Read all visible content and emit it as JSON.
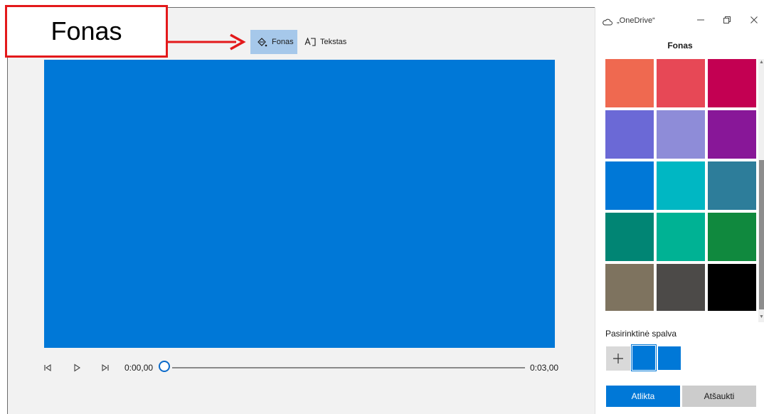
{
  "toolbar": {
    "background_label": "Fonas",
    "text_label": "Tekstas"
  },
  "callout": {
    "label": "Fonas",
    "color": "#e3191b"
  },
  "preview": {
    "color": "#0078d7"
  },
  "playback": {
    "current_time": "0:00,00",
    "total_time": "0:03,00",
    "progress": 0
  },
  "panel": {
    "app_title": "„OneDrive“",
    "title": "Fonas",
    "swatches": [
      "#ef6950",
      "#e74856",
      "#c30052",
      "#6b69d6",
      "#8e8cd8",
      "#881798",
      "#0078d7",
      "#00b7c3",
      "#2d7d9a",
      "#018574",
      "#00b294",
      "#10893e",
      "#7e735f",
      "#4c4a48",
      "#000000"
    ],
    "custom_label": "Pasirinktinė spalva",
    "custom_colors": [
      "#0078d7",
      "#0078d7"
    ],
    "done_label": "Atlikta",
    "cancel_label": "Atšaukti",
    "icons": {
      "app": "cloud-icon",
      "minimize": "minimize-icon",
      "restore": "restore-icon",
      "close": "close-icon",
      "add": "plus-icon"
    }
  }
}
